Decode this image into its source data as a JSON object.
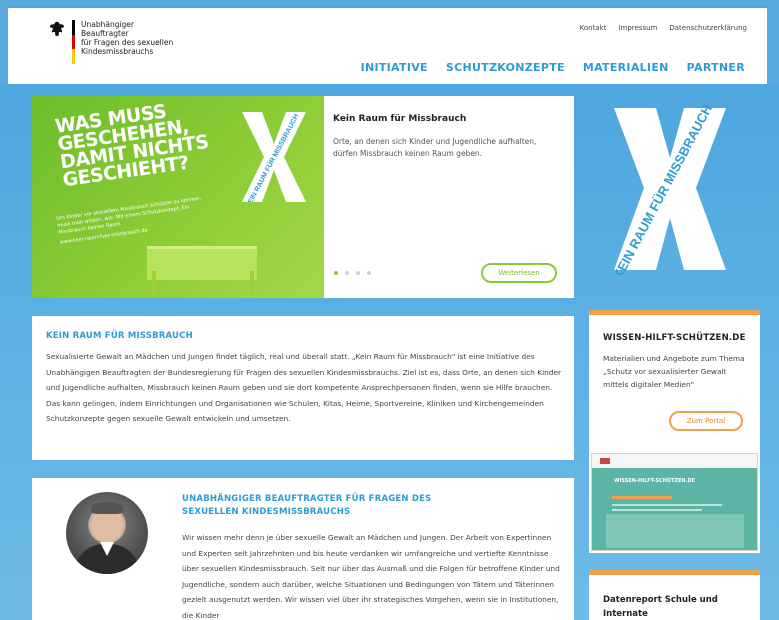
{
  "header": {
    "logo_lines": [
      "Unabhängiger Beauftragter",
      "für Fragen des sexuellen",
      "Kindesmissbrauchs"
    ],
    "meta_nav": [
      "Kontakt",
      "Impressum",
      "Datenschutzerklärung"
    ],
    "main_nav": [
      "INITIATIVE",
      "SCHUTZKONZEPTE",
      "MATERIALIEN",
      "PARTNER"
    ]
  },
  "hero": {
    "headline": "WAS MUSS GESCHEHEN, DAMIT NICHTS GESCHIEHT?",
    "small_text": "Um Kinder vor sexuellem Missbrauch schützen zu können, muss man wissen, wie. Mit einem Schutzkonzept. Ein Missbrauch keinen Raum.",
    "small_url": "www.kein-raum-fuer-missbrauch.de",
    "x_label": "KEIN RAUM FÜR MISSBRAUCH",
    "title": "Kein Raum für Missbrauch",
    "description": "Orte, an denen sich Kinder und Jugendliche aufhalten, dürfen Missbrauch keinen Raum geben.",
    "button": "Weiterlesen",
    "slide_count": 4,
    "active_slide": 1
  },
  "side_logo_text": "KEIN RAUM FÜR MISSBRAUCH",
  "intro": {
    "title": "KEIN RAUM FÜR MISSBRAUCH",
    "text": "Sexualisierte Gewalt an Mädchen und Jungen findet täglich, real und überall statt. „Kein Raum für Missbrauch\" ist eine Initiative des Unabhängigen Beauftragten der Bundesregierung für Fragen des sexuellen Kindesmissbrauchs. Ziel ist es, dass Orte, an denen sich Kinder und Jugendliche aufhalten, Missbrauch keinen Raum geben und sie dort kompetente Ansprechpersonen finden, wenn sie Hilfe brauchen. Das kann gelingen, indem Einrichtungen und Organisationen wie Schulen, Kitas, Heime, Sportvereine, Kliniken und Kirchengemeinden Schutzkonzepte gegen sexuelle Gewalt entwickeln und umsetzen."
  },
  "uba": {
    "title": "UNABHÄNGIGER BEAUFTRAGTER FÜR FRAGEN DES SEXUELLEN KINDESMISSBRAUCHS",
    "text": "Wir wissen mehr denn je über sexuelle Gewalt an Mädchen und Jungen. Der Arbeit von Expertinnen und Experten seit Jahrzehnten und bis heute verdanken wir umfangreiche und vertiefte Kenntnisse über sexuellen Kindesmissbrauch. Seit nur über das Ausmaß und die Folgen für betroffene Kinder und Jugendliche, sondern auch darüber, welche Situationen und Bedingungen von Tätern und Täterinnen gezielt ausgenutzt werden. Wir wissen viel über ihr strategisches Vorgehen, wenn sie in Institutionen, die Kinder"
  },
  "sidebar": {
    "card1": {
      "title": "WISSEN-HILFT-SCHÜTZEN.DE",
      "text": "Materialien und Angebote zum Thema „Schutz vor sexualisierter Gewalt mittels digitaler Medien\"",
      "button": "Zum Portal",
      "screenshot_title": "WISSEN-HILFT-SCHÜTZEN.DE"
    },
    "card2": {
      "title": "Datenreport Schule und Internate"
    }
  },
  "colors": {
    "accent_blue": "#2e9bd6",
    "hero_green": "#8cc63f",
    "orange": "#f0a048",
    "page_bg": "#5aa9dc"
  }
}
